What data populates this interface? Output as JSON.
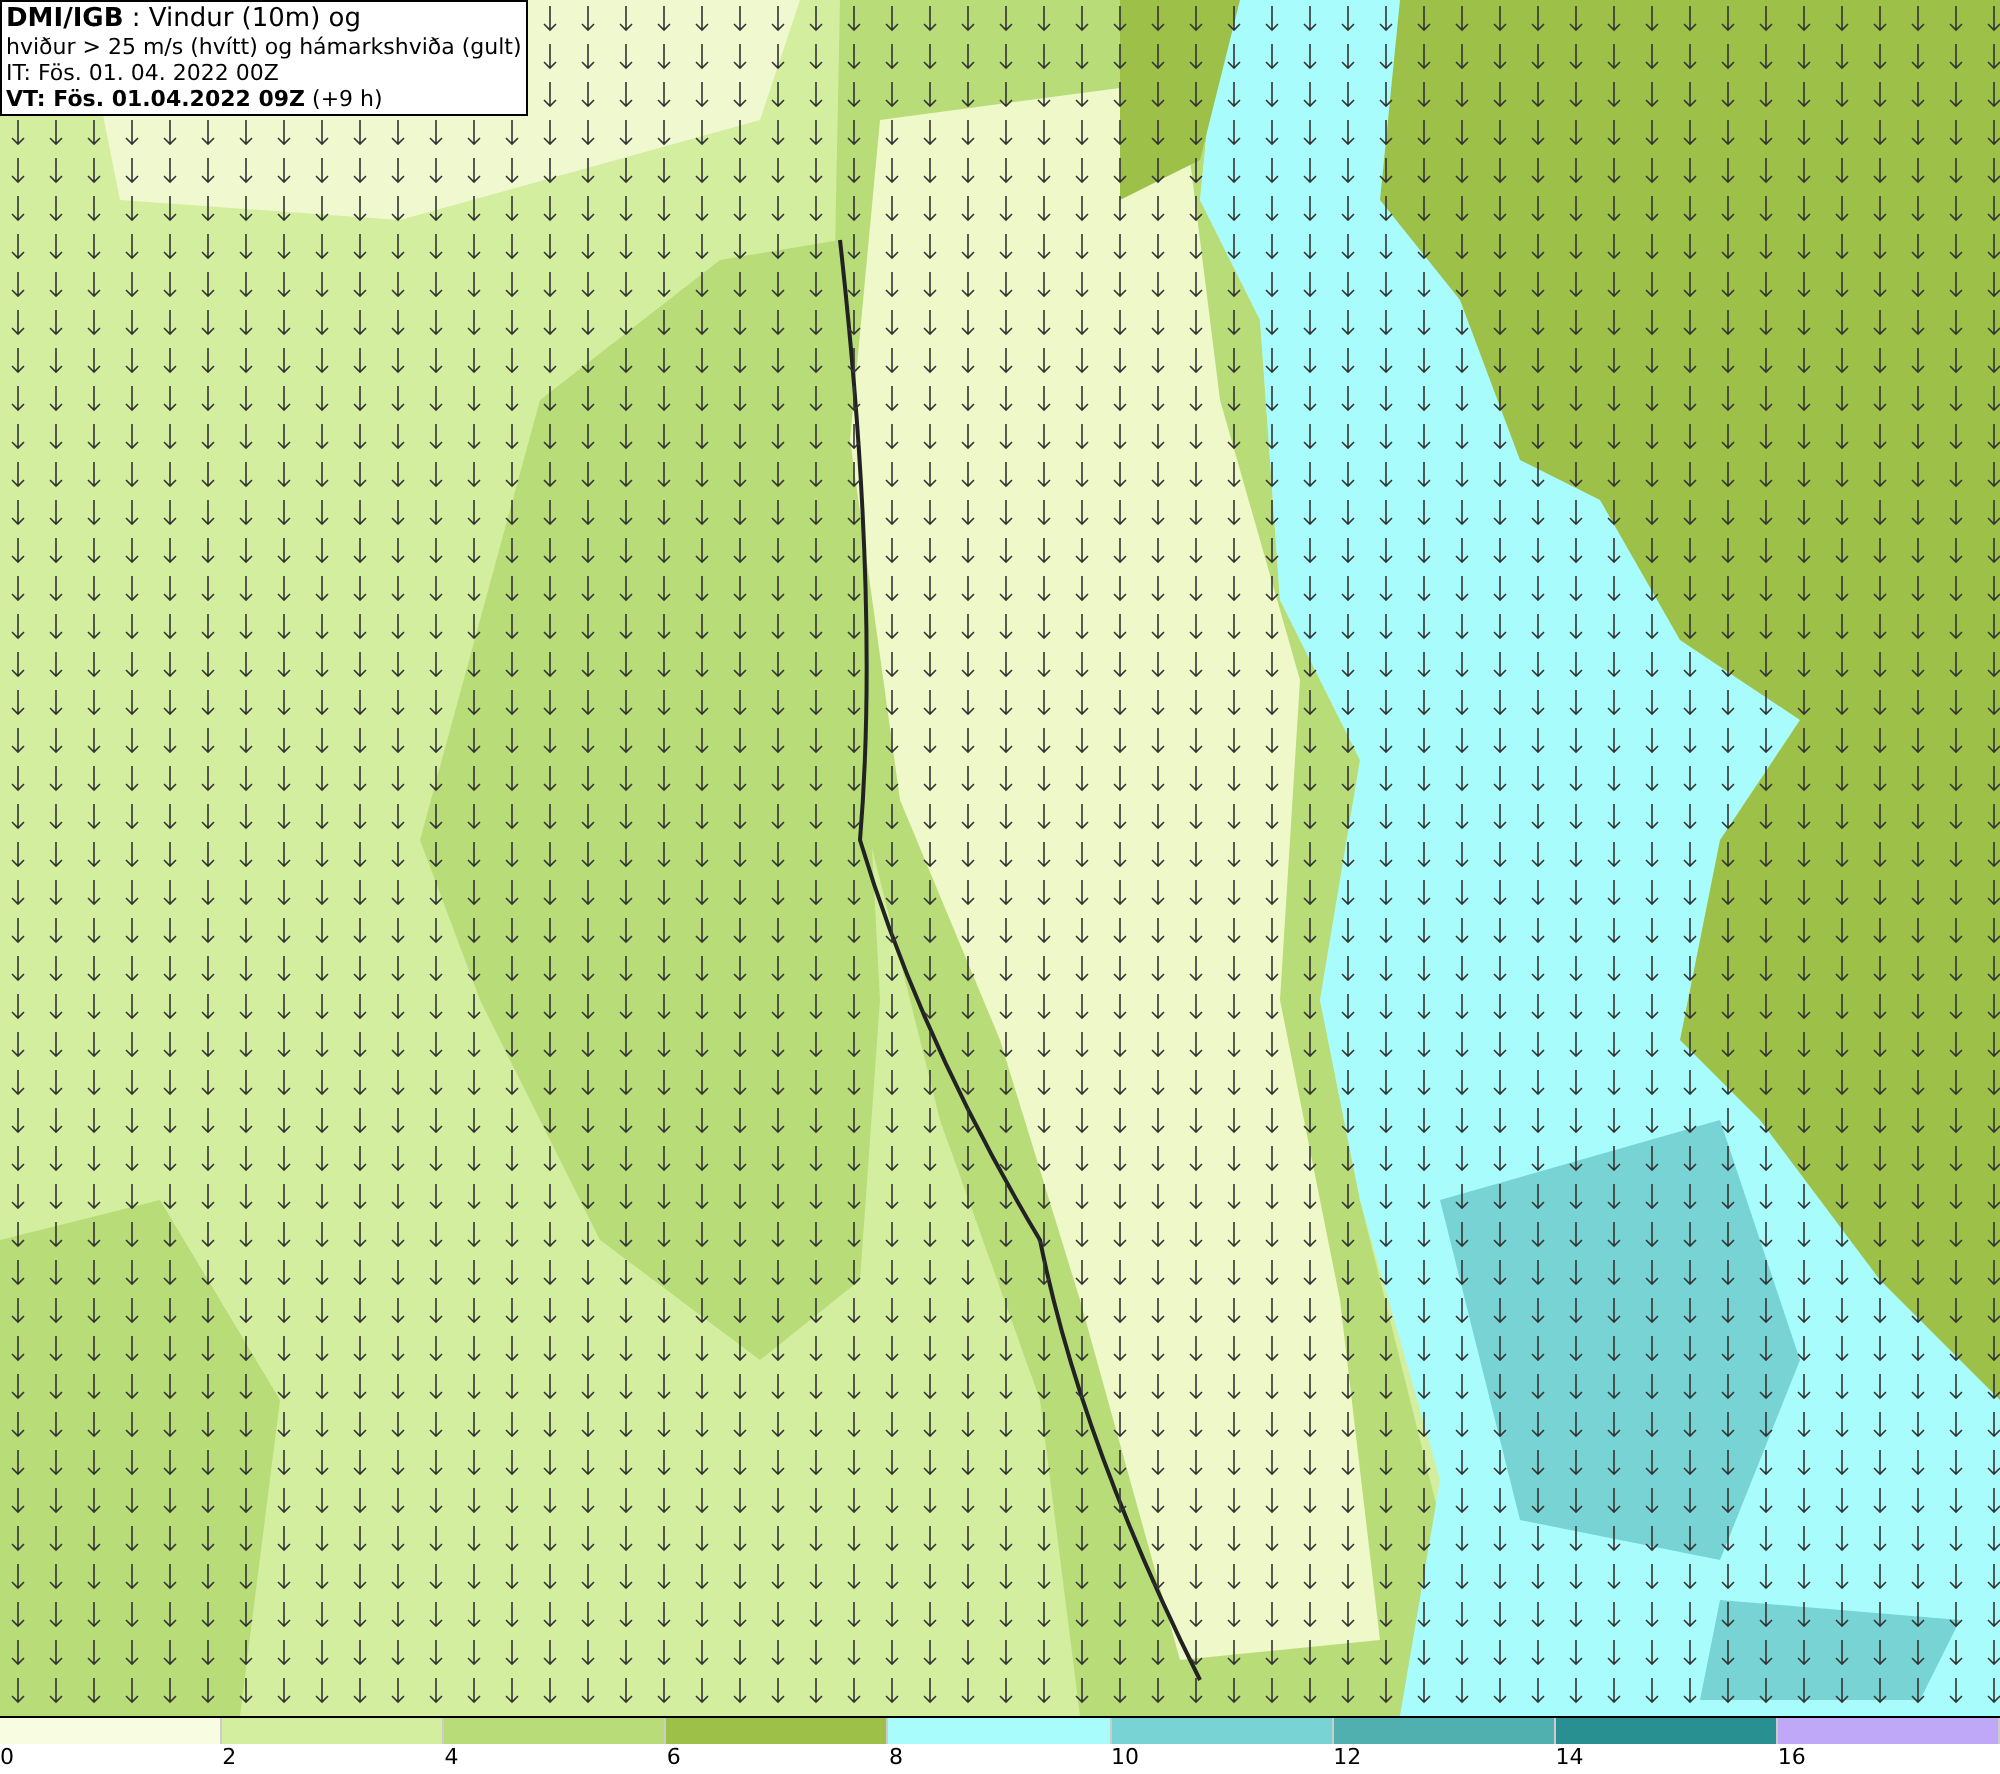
{
  "title_box": {
    "lines": [
      "**DMI/IGB** : Vindur (10m) og",
      "hviður > 25 m/s (hvítt) og hámarkshviða (gult)",
      "IT: Fös. 01. 04. 2022 00Z",
      "**VT: Fös. 01.04.2022 09Z** (+9 h)"
    ]
  },
  "legend": {
    "bins": [
      {
        "color": "#f8fce0"
      },
      {
        "color": "#d4eea0"
      },
      {
        "color": "#b8dc78"
      },
      {
        "color": "#9cc048"
      },
      {
        "color": "#a8fcfc"
      },
      {
        "color": "#78d4d4"
      },
      {
        "color": "#50b0b0"
      },
      {
        "color": "#289090"
      },
      {
        "color": "#c0a8f8"
      }
    ],
    "ticks": [
      "0",
      "2",
      "4",
      "6",
      "8",
      "10",
      "12",
      "14",
      "16"
    ]
  }
}
